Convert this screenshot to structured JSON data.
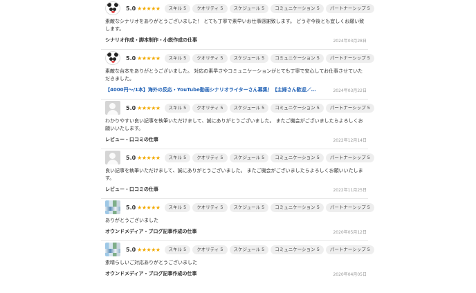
{
  "reviews": [
    {
      "avatar": "panda-avatar",
      "score": "5.0",
      "stars": "★★★★★",
      "tags": [
        "スキル 5",
        "クオリティ 5",
        "スケジュール 5",
        "コミュニケーション 5",
        "パートナーシップ 5"
      ],
      "body": "素敵なシナリオをありがとうございました！ とても丁寧で素早いお仕事感謝致します。 どうぞ今後とも宜しくお願い致します。",
      "job": "シナリオ作成・脚本制作・小説作成の仕事",
      "job_is_link": false,
      "date": "2024年03月28日"
    },
    {
      "avatar": "panda-avatar",
      "score": "5.0",
      "stars": "★★★★★",
      "tags": [
        "スキル 5",
        "クオリティ 5",
        "スケジュール 5",
        "コミュニケーション 5",
        "パートナーシップ 5"
      ],
      "body": "素敵な台本をありがとうございました。 対応の素早さやコミュニケーションがとても丁寧で安心してお仕事させていただきました。",
      "job": "【4000円〜/1本】海外の反応・YouTube動画シナリオライターさん募集！【主婦さん歓迎／…",
      "job_is_link": true,
      "date": "2024年03月22日"
    },
    {
      "avatar": "default-avatar",
      "score": "5.0",
      "stars": "★★★★★",
      "tags": [
        "スキル 5",
        "クオリティ 5",
        "スケジュール 5",
        "コミュニケーション 5",
        "パートナーシップ 5"
      ],
      "body": "わかりやすい良い記事を執筆いただけまして、誠にありがとうございました。 またご機会がございましたらよろしくお願いいたします。",
      "job": "レビュー・口コミの仕事",
      "job_is_link": false,
      "date": "2022年12月14日"
    },
    {
      "avatar": "default-avatar",
      "score": "5.0",
      "stars": "★★★★★",
      "tags": [
        "スキル 5",
        "クオリティ 5",
        "スケジュール 5",
        "コミュニケーション 5",
        "パートナーシップ 5"
      ],
      "body": "良い記事を執筆いただけまして、誠にありがとうございました。 またご機会がございましたらよろしくお願いいたします。",
      "job": "レビュー・口コミの仕事",
      "job_is_link": false,
      "date": "2022年11月25日"
    },
    {
      "avatar": "mosaic-avatar",
      "score": "5.0",
      "stars": "★★★★★",
      "tags": [
        "スキル 5",
        "クオリティ 5",
        "スケジュール 5",
        "コミュニケーション 5",
        "パートナーシップ 5"
      ],
      "body": "ありがとうございました",
      "job": "オウンドメディア・ブログ記事作成の仕事",
      "job_is_link": false,
      "date": "2020年05月12日"
    },
    {
      "avatar": "mosaic-avatar",
      "score": "5.0",
      "stars": "★★★★★",
      "tags": [
        "スキル 5",
        "クオリティ 5",
        "スケジュール 5",
        "コミュニケーション 5",
        "パートナーシップ 5"
      ],
      "body": "素晴らしいご対応ありがとうございました",
      "job": "オウンドメディア・ブログ記事作成の仕事",
      "job_is_link": false,
      "date": "2020年04月05日"
    }
  ]
}
